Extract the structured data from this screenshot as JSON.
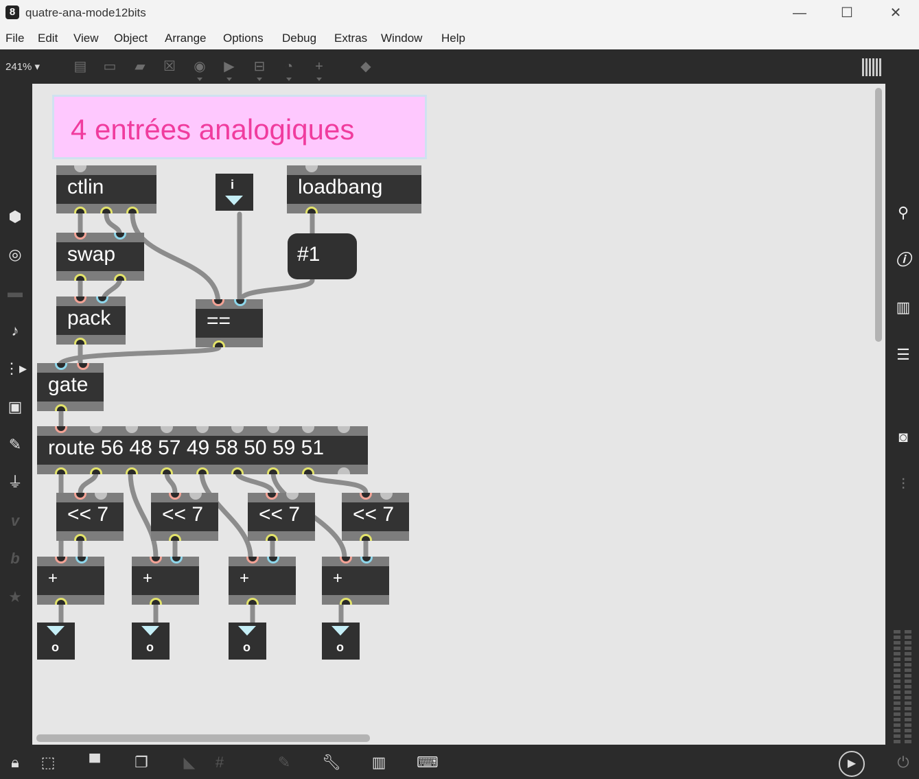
{
  "window": {
    "title": "quatre-ana-mode12bits",
    "minimize": "—",
    "maximize": "☐",
    "close": "✕"
  },
  "menu": [
    "File",
    "Edit",
    "View",
    "Object",
    "Arrange",
    "Options",
    "Debug",
    "Extras",
    "Window",
    "Help"
  ],
  "toolbar": {
    "zoom": "241%",
    "icons": [
      "object-box-icon",
      "message-box-icon",
      "comment-icon",
      "toggle-icon",
      "button-icon",
      "playbar-icon",
      "slider-icon",
      "dial-icon",
      "add-icon",
      "paint-icon"
    ]
  },
  "patch": {
    "comment": "4 entrées analogiques",
    "objects": {
      "ctlin": "ctlin",
      "swap": "swap",
      "pack": "pack",
      "loadbang": "loadbang",
      "equals": "==",
      "gate": "gate",
      "route": "route 56 48 57 49 58 50 59 51",
      "shift1": "<< 7",
      "shift2": "<< 7",
      "shift3": "<< 7",
      "shift4": "<< 7",
      "plus1": "+",
      "plus2": "+",
      "plus3": "+",
      "plus4": "+"
    },
    "message": "#1",
    "int_number_label": "i",
    "number_outputs": [
      "o",
      "o",
      "o",
      "o"
    ]
  },
  "left_sidebar": [
    "cube-icon",
    "circle-target-icon",
    "media-icon",
    "music-note-icon",
    "step-icon",
    "image-icon",
    "paperclip-icon",
    "plug-icon",
    "v-icon",
    "b-icon",
    "star-icon"
  ],
  "right_sidebar": [
    "search-icon",
    "info-icon",
    "book-icon",
    "list-icon",
    "camera-icon",
    "mixer-icon"
  ],
  "bottom_bar": [
    "lock-icon",
    "select-icon",
    "presentation-icon",
    "windows-icon",
    "hide-icon",
    "grid-icon",
    "attach-icon",
    "wrench-icon",
    "piano-icon",
    "keyboard-icon",
    "play-icon",
    "power-icon"
  ]
}
